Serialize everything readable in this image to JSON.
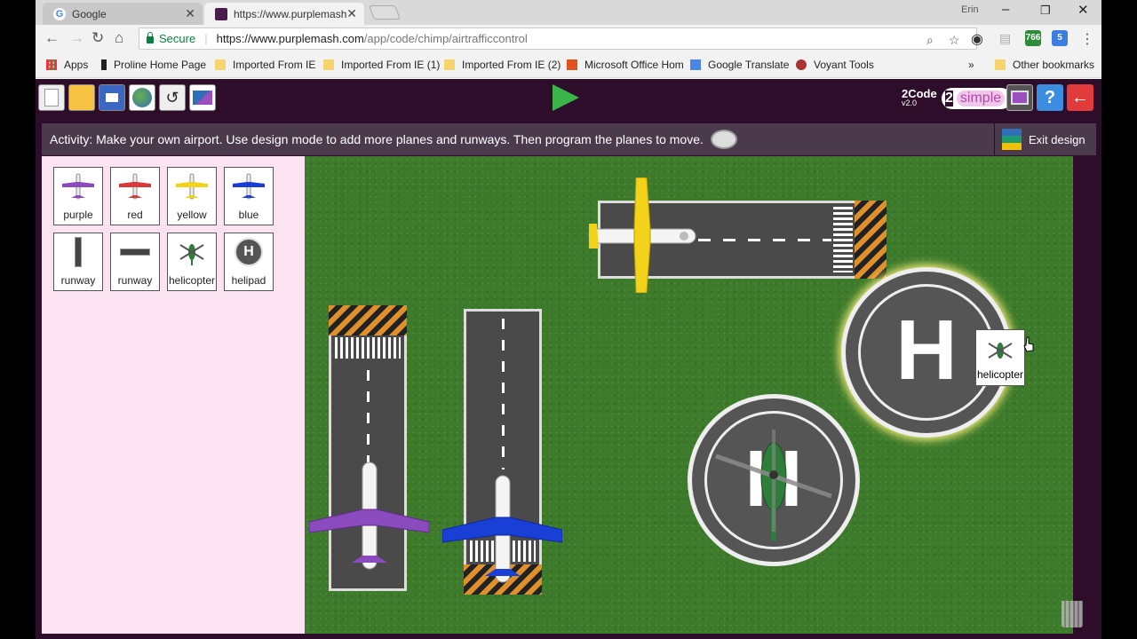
{
  "browser": {
    "tabs": [
      {
        "title": "Google",
        "favicon": "google-icon"
      },
      {
        "title": "https://www.purplemash",
        "favicon": "purplemash-icon"
      }
    ],
    "user_badge": "Erin",
    "secure_label": "Secure",
    "url_host": "https://www.purplemash.com",
    "url_path": "/app/code/chimp/airtrafficcontrol",
    "extension_badges": [
      "766",
      "5"
    ]
  },
  "bookmarks": {
    "items": [
      "Apps",
      "Proline Home Page",
      "Imported From IE",
      "Imported From IE (1)",
      "Imported From IE (2)",
      "Microsoft Office Hom",
      "Google Translate",
      "Voyant Tools"
    ],
    "overflow": "»",
    "other": "Other bookmarks"
  },
  "app": {
    "brand": "2Code",
    "version": "v2.0",
    "simple_logo": "2simple",
    "activity_text": "Activity: Make your own airport. Use design mode to add more planes and runways. Then program the planes to move.",
    "exit_label": "Exit design",
    "palette": [
      {
        "label": "purple",
        "color": "#8b4bbf"
      },
      {
        "label": "red",
        "color": "#d83a3a"
      },
      {
        "label": "yellow",
        "color": "#f2d21b"
      },
      {
        "label": "blue",
        "color": "#1a3fd6"
      },
      {
        "label": "runway"
      },
      {
        "label": "runway"
      },
      {
        "label": "helicopter"
      },
      {
        "label": "helipad"
      }
    ],
    "helipad_letter": "H",
    "drag_tooltip": "helicopter"
  }
}
